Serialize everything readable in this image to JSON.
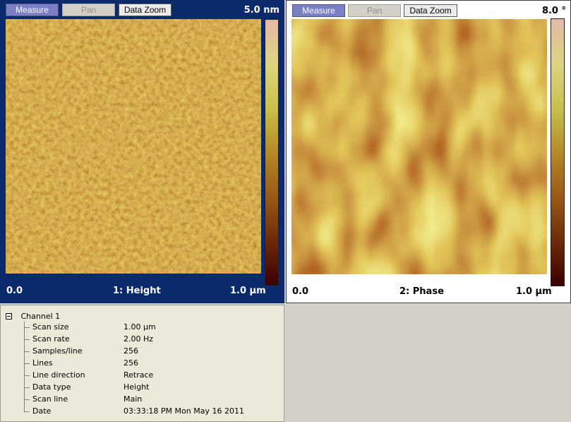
{
  "panels": [
    {
      "toolbar": {
        "measure": "Measure",
        "pan": "Pan",
        "zoom": "Data Zoom"
      },
      "scale_max": "5.0 nm",
      "x_start": "0.0",
      "title": "1: Height",
      "x_end": "1.0 µm",
      "colors": {
        "dark": "#5c1100",
        "mid": "#a8701c",
        "light": "#e8d86a"
      }
    },
    {
      "toolbar": {
        "measure": "Measure",
        "pan": "Pan",
        "zoom": "Data Zoom"
      },
      "scale_max": "8.0 °",
      "x_start": "0.0",
      "title": "2: Phase",
      "x_end": "1.0 µm",
      "colors": {
        "dark": "#5c1100",
        "mid": "#b07c1c",
        "light": "#f2ea8a"
      }
    }
  ],
  "colorbar_colors": [
    "#3a0000",
    "#6e2a08",
    "#9c5a16",
    "#b48a26",
    "#c8c04a",
    "#dcd480",
    "#e6b8a6"
  ],
  "info": {
    "root": "Channel 1",
    "rows": [
      {
        "key": "Scan size",
        "value": "1.00 µm"
      },
      {
        "key": "Scan rate",
        "value": "2.00 Hz"
      },
      {
        "key": "Samples/line",
        "value": "256"
      },
      {
        "key": "Lines",
        "value": "256"
      },
      {
        "key": "Line direction",
        "value": "Retrace"
      },
      {
        "key": "Data type",
        "value": "Height"
      },
      {
        "key": "Scan line",
        "value": "Main"
      },
      {
        "key": "Date",
        "value": "03:33:18 PM Mon May 16 2011"
      }
    ]
  }
}
